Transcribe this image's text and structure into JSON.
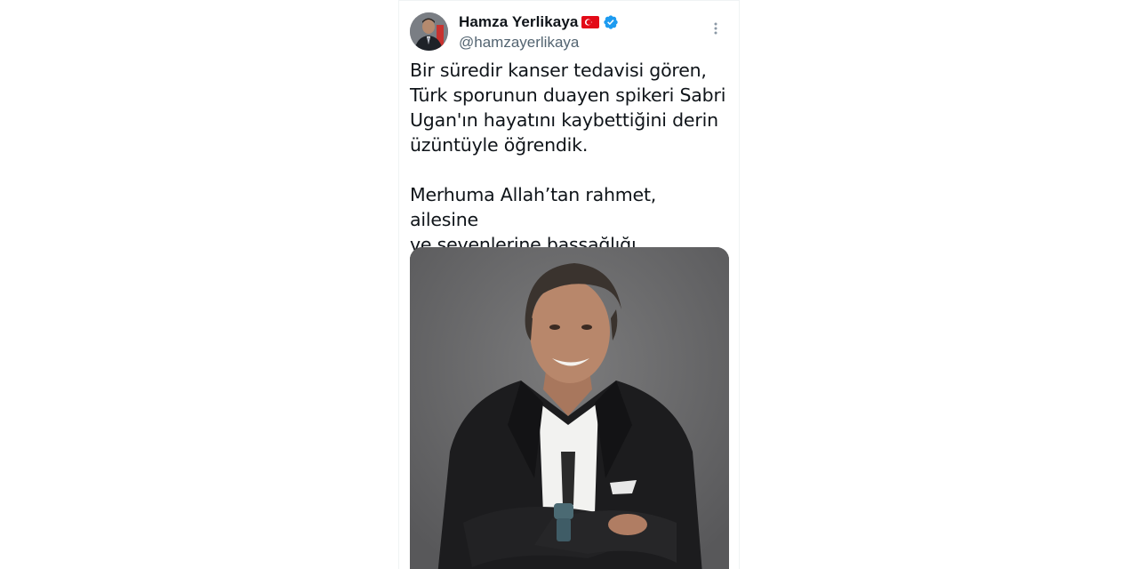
{
  "tweet": {
    "author": {
      "display_name": "Hamza Yerlikaya",
      "handle": "@hamzayerlikaya",
      "flag_icon": "turkey-flag-icon",
      "verified_icon": "verified-badge-icon",
      "verified_color": "#1d9bf0"
    },
    "more_icon": "more-options-icon",
    "text": "Bir süredir kanser tedavisi gören,\nTürk sporunun duayen spikeri Sabri\nUgan'ın hayatını kaybettiğini derin\nüzüntüyle öğrendik.\n\nMerhuma Allah’tan rahmet, ailesine\nve sevenlerine başsağlığı diliyorum.",
    "media": {
      "type": "photo",
      "background": "#6f6f70"
    }
  },
  "colors": {
    "text_primary": "#0f1419",
    "text_secondary": "#536471",
    "border": "#eff3f4"
  }
}
